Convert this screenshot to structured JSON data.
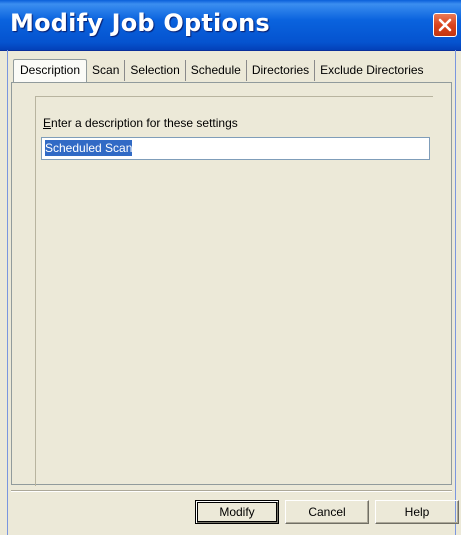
{
  "window": {
    "title": "Modify Job Options",
    "close_icon": "close-icon"
  },
  "tabs": [
    {
      "label": "Description",
      "selected": true
    },
    {
      "label": "Scan",
      "selected": false
    },
    {
      "label": "Selection",
      "selected": false
    },
    {
      "label": "Schedule",
      "selected": false
    },
    {
      "label": "Directories",
      "selected": false
    },
    {
      "label": "Exclude Directories",
      "selected": false
    }
  ],
  "description": {
    "label_accel": "E",
    "label_rest": "nter a description for these settings",
    "value": "Scheduled Scan"
  },
  "buttons": {
    "modify": "Modify",
    "cancel": "Cancel",
    "help": "Help"
  },
  "colors": {
    "titlebar": "#0a5fd9",
    "close_button": "#d9441e",
    "dialog_bg": "#ece9d8",
    "selection": "#316ac5"
  }
}
